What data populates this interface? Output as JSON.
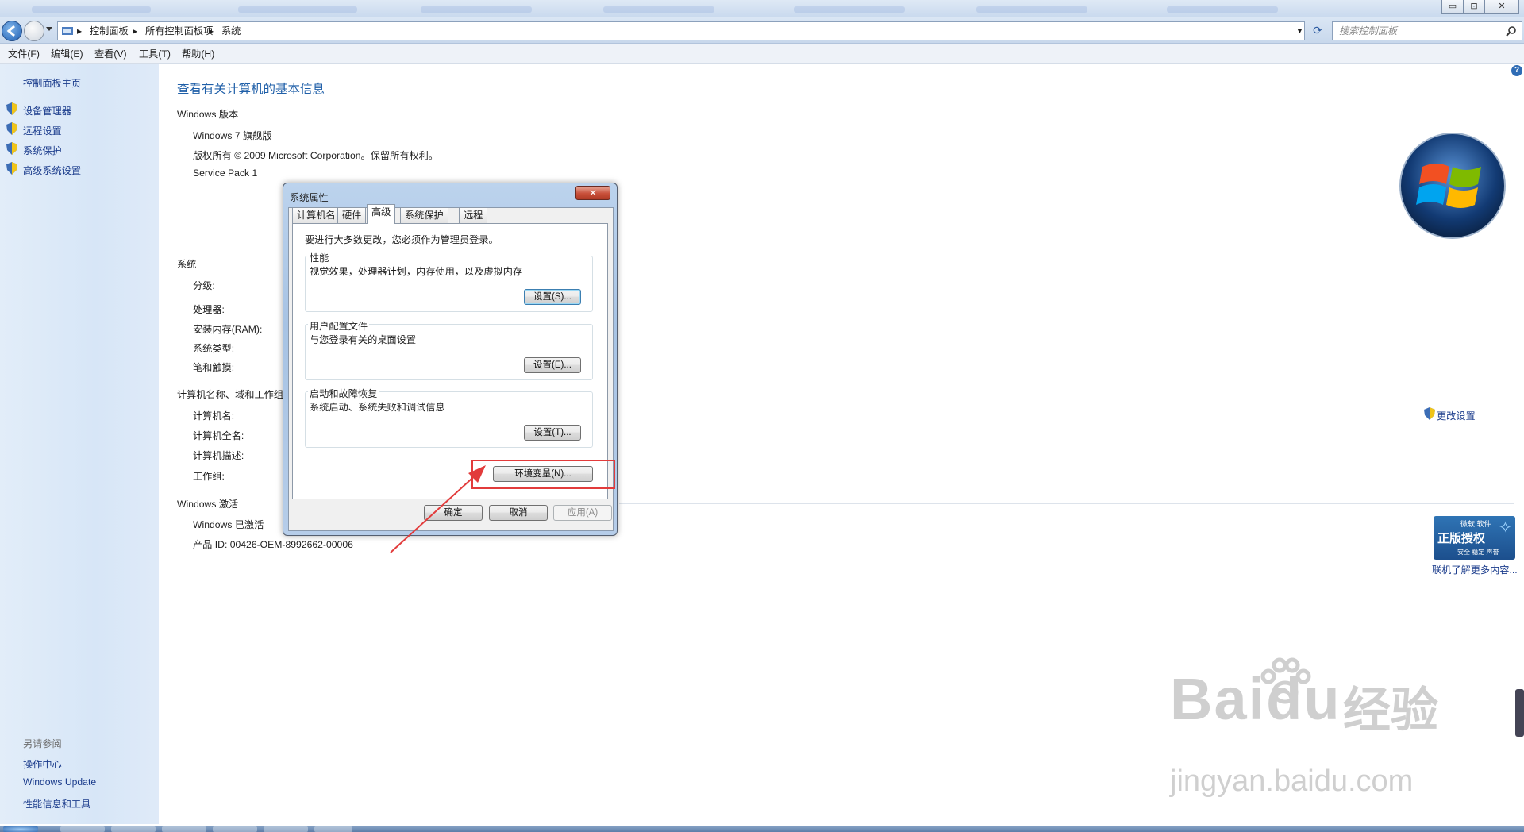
{
  "window": {
    "controls": {
      "minimize": "▭",
      "maximize": "⊡",
      "close": "✕"
    }
  },
  "address": {
    "segments": [
      "控制面板",
      "所有控制面板项",
      "系统"
    ],
    "search_placeholder": "搜索控制面板"
  },
  "menubar": [
    "文件(F)",
    "编辑(E)",
    "查看(V)",
    "工具(T)",
    "帮助(H)"
  ],
  "left_pane": {
    "home": "控制面板主页",
    "tasks": [
      "设备管理器",
      "远程设置",
      "系统保护",
      "高级系统设置"
    ],
    "see_also_title": "另请参阅",
    "see_also": [
      "操作中心",
      "Windows Update",
      "性能信息和工具"
    ]
  },
  "main": {
    "title": "查看有关计算机的基本信息",
    "edition": {
      "header": "Windows 版本",
      "name": "Windows 7 旗舰版",
      "copyright": "版权所有 © 2009 Microsoft Corporation。保留所有权利。",
      "service_pack": "Service Pack 1"
    },
    "system": {
      "header": "系统",
      "labels": [
        "分级:",
        "处理器:",
        "安装内存(RAM):",
        "系统类型:",
        "笔和触摸:"
      ]
    },
    "computer": {
      "header": "计算机名称、域和工作组",
      "labels": [
        "计算机名:",
        "计算机全名:",
        "计算机描述:",
        "工作组:"
      ],
      "change_settings": "更改设置"
    },
    "activation": {
      "header": "Windows 激活",
      "status": "Windows 已激活",
      "product_id": "产品 ID: 00426-OEM-8992662-00006"
    }
  },
  "genuine_badge": {
    "top": "微软 软件",
    "big": "正版授权",
    "sub": "安全 稳定 声誉",
    "link": "联机了解更多内容..."
  },
  "dialog": {
    "title": "系统属性",
    "close": "✕",
    "tabs": [
      "计算机名",
      "硬件",
      "高级",
      "系统保护",
      "远程"
    ],
    "active_tab": "高级",
    "admin_note": "要进行大多数更改，您必须作为管理员登录。",
    "groups": [
      {
        "label": "性能",
        "desc": "视觉效果，处理器计划，内存使用，以及虚拟内存",
        "button": "设置(S)..."
      },
      {
        "label": "用户配置文件",
        "desc": "与您登录有关的桌面设置",
        "button": "设置(E)..."
      },
      {
        "label": "启动和故障恢复",
        "desc": "系统启动、系统失败和调试信息",
        "button": "设置(T)..."
      }
    ],
    "env_button": "环境变量(N)...",
    "ok": "确定",
    "cancel": "取消",
    "apply": "应用(A)"
  },
  "watermark": {
    "brand": "Baidu",
    "cn": "经验",
    "url": "jingyan.baidu.com"
  },
  "colors": {
    "link": "#1b3c8c",
    "title": "#1f5fa8",
    "annotation": "#e23b3b"
  }
}
